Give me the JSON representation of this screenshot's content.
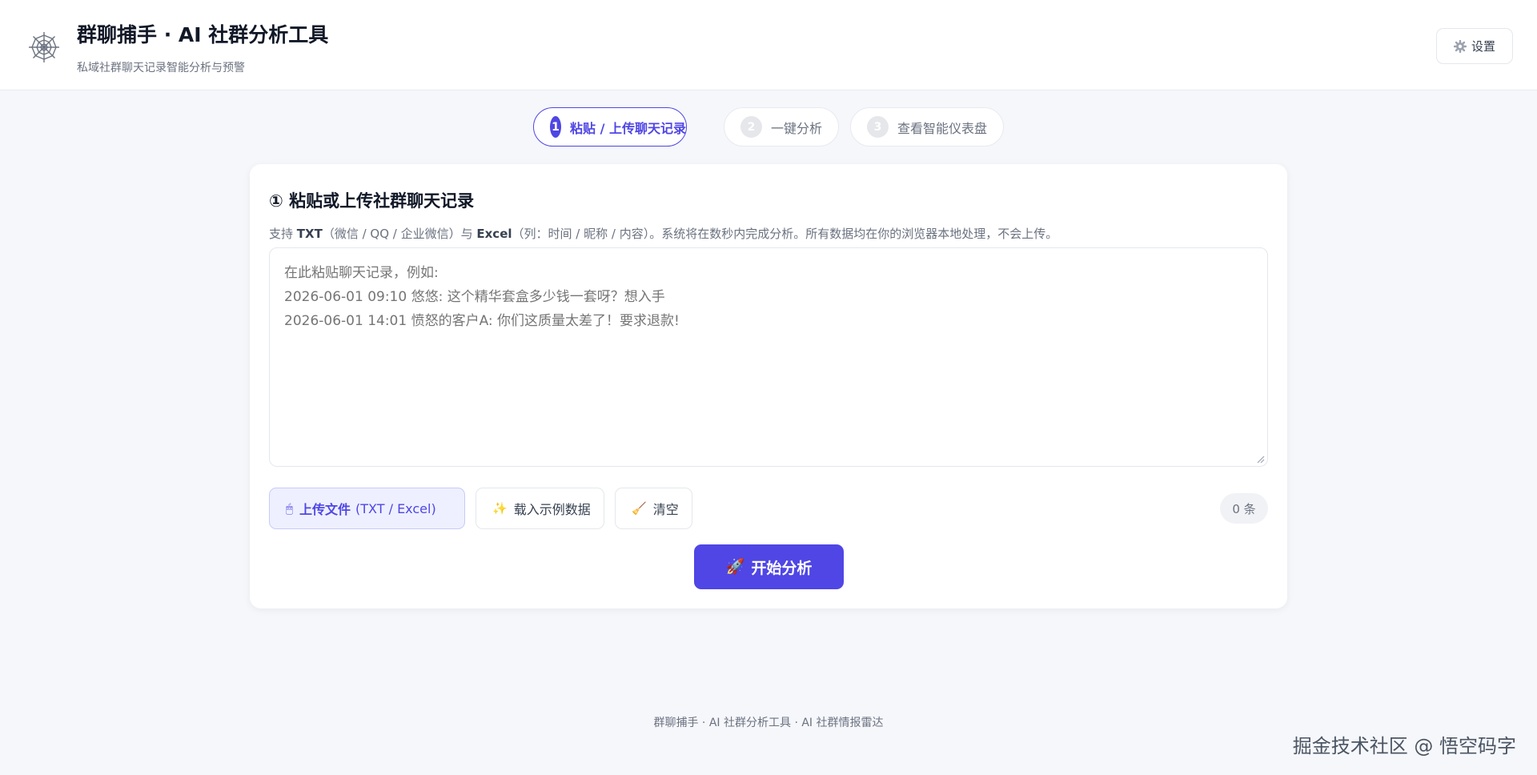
{
  "header": {
    "title": "群聊捕手 · AI 社群分析工具",
    "subtitle": "私域社群聊天记录智能分析与预警",
    "logo_icon": "spider-web-icon",
    "settings_label": "设置"
  },
  "steps": [
    {
      "number": "1",
      "label": "粘贴 / 上传聊天记录",
      "active": true
    },
    {
      "number": "2",
      "label": "一键分析",
      "active": false
    },
    {
      "number": "3",
      "label": "查看智能仪表盘",
      "active": false
    }
  ],
  "card": {
    "title": "① 粘贴或上传社群聊天记录",
    "desc_prefix": "支持 ",
    "desc_txt": "TXT",
    "desc_txt_note": "（微信 / QQ / 企业微信）与 ",
    "desc_excel": "Excel",
    "desc_suffix": "（列：时间 / 昵称 / 内容）。系统将在数秒内完成分析。所有数据均在你的浏览器本地处理，不会上传。",
    "textarea_placeholder": "在此粘贴聊天记录，例如:\n2026-06-01 09:10 悠悠: 这个精华套盒多少钱一套呀？想入手\n2026-06-01 14:01 愤怒的客户A: 你们这质量太差了！要求退款!",
    "upload_label": "上传文件",
    "upload_formats": "(TXT / Excel)",
    "upload_emoji": "🖱",
    "sample_label": "载入示例数据",
    "sample_emoji": "✨",
    "clear_label": "清空",
    "clear_emoji": "🧹",
    "count": "0 条",
    "analyze_label": "开始分析",
    "analyze_emoji": "🚀"
  },
  "footer": "群聊捕手 · AI 社群分析工具 · AI 社群情报雷达",
  "watermark": "掘金技术社区 @ 悟空码字",
  "colors": {
    "accent": "#4f46e5",
    "background": "#f6f7fb"
  }
}
